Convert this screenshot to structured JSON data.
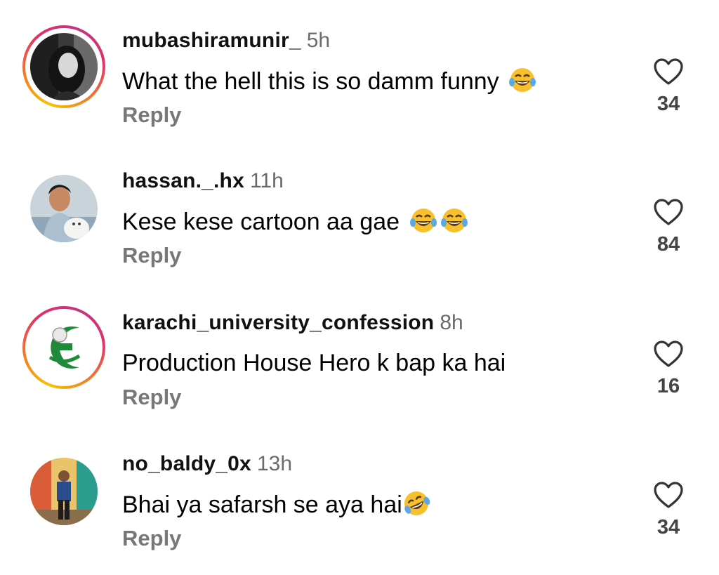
{
  "comments": [
    {
      "username": "mubashiramunir_",
      "time": "5h",
      "text": "What the hell this is so damm funny",
      "emoji": [
        "joy"
      ],
      "reply": "Reply",
      "likes": "34",
      "story_ring": true
    },
    {
      "username": "hassan._.hx",
      "time": "11h",
      "text": "Kese kese cartoon aa gae",
      "emoji": [
        "joy",
        "joy"
      ],
      "reply": "Reply",
      "likes": "84",
      "story_ring": false
    },
    {
      "username": "karachi_university_confession",
      "time": "8h",
      "text": "Production House Hero k bap ka hai",
      "emoji": [],
      "reply": "Reply",
      "likes": "16",
      "story_ring": true
    },
    {
      "username": "no_baldy_0x",
      "time": "13h",
      "text": "Bhai ya safarsh se aya hai",
      "emoji": [
        "rofl"
      ],
      "reply": "Reply",
      "likes": "34",
      "story_ring": false
    }
  ],
  "colors": {
    "story_ring": "#e1306c",
    "reply": "#777777",
    "time": "#6b6b6b",
    "emoji": "#f7c02c"
  }
}
